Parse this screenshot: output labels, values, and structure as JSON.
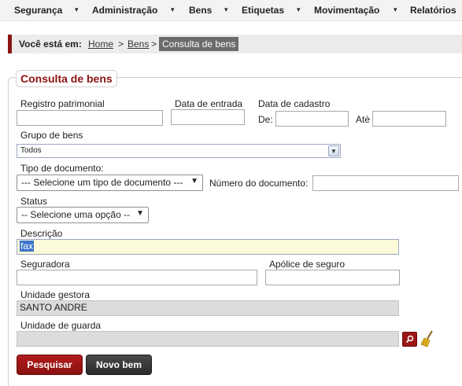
{
  "menu": {
    "items": [
      "Segurança",
      "Administração",
      "Bens",
      "Etiquetas",
      "Movimentação",
      "Relatórios"
    ],
    "arrow": "▾"
  },
  "breadcrumb": {
    "prefix": "Você está em:",
    "links": [
      "Home",
      "Bens"
    ],
    "separator": ">",
    "current": "Consulta de bens"
  },
  "form": {
    "title": "Consulta de bens",
    "registro_label": "Registro patrimonial",
    "registro_value": "",
    "data_entrada_label": "Data de entrada",
    "data_entrada_value": "",
    "data_cadastro_label": "Data de cadastro",
    "de_label": "De:",
    "de_value": "",
    "ate_label": "Atè",
    "ate_value": "",
    "grupo_label": "Grupo de bens",
    "grupo_value": "Todos",
    "tipo_doc_label": "Tipo de documento:",
    "tipo_doc_value": "--- Selecione um tipo de documento ---",
    "numero_doc_label": "Número do documento:",
    "numero_doc_value": "",
    "status_label": "Status",
    "status_value": "-- Selecione uma opção --",
    "descricao_label": "Descrição",
    "descricao_value": "fax",
    "seguradora_label": "Seguradora",
    "seguradora_value": "",
    "apolice_label": "Apólice de seguro",
    "apolice_value": "",
    "unidade_gestora_label": "Unidade gestora",
    "unidade_gestora_value": "SANTO ANDRE",
    "unidade_guarda_label": "Unidade de guarda",
    "unidade_guarda_value": ""
  },
  "actions": {
    "pesquisar": "Pesquisar",
    "novo_bem": "Novo bem",
    "lookup_icon": "search-icon",
    "clear_icon": "broom-icon"
  },
  "colors": {
    "accent": "#8b1414",
    "primary_button": "#9c1515",
    "secondary_button": "#333333",
    "focused_field": "#fbfbd9"
  }
}
